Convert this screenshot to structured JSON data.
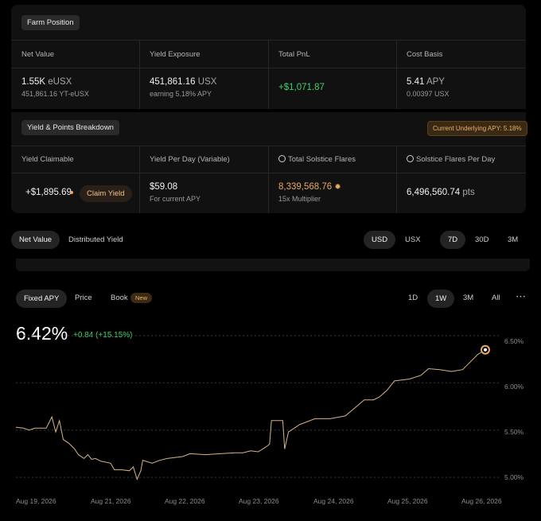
{
  "farm": {
    "section_title": "Farm Position",
    "columns": [
      {
        "label": "Net Value",
        "value": "1.55K",
        "unit": "eUSX",
        "sub": "451,861.16 YT-eUSX"
      },
      {
        "label": "Yield Exposure",
        "value": "451,861.16",
        "unit": "USX",
        "sub": "earning 5.18% APY"
      },
      {
        "label": "Total PnL",
        "value": "+$1,071.87",
        "unit": "",
        "sub": ""
      },
      {
        "label": "Cost Basis",
        "value": "5.41",
        "unit": "APY",
        "sub": "0.00397 USX"
      }
    ]
  },
  "breakdown": {
    "section_title": "Yield & Points Breakdown",
    "badge": "Current Underlying APY: 5.18%",
    "columns": [
      {
        "label": "Yield Claimable",
        "value": "+$1,895.69",
        "button": "Claim Yield"
      },
      {
        "label": "Yield Per Day (Variable)",
        "value": "$59.08",
        "sub": "For current APY"
      },
      {
        "label": "Total Solstice Flares",
        "value": "8,339,568.76",
        "sub": "15x Multiplier"
      },
      {
        "label": "Solstice Flares Per Day",
        "value": "6,496,560.74",
        "unit": "pts"
      }
    ]
  },
  "view_tabs": {
    "net_value": "Net Value",
    "distributed_yield": "Distributed Yield"
  },
  "currency_tabs": {
    "usd": "USD",
    "usx": "USX"
  },
  "range_tabs": {
    "d7": "7D",
    "d30": "30D",
    "m3": "3M"
  },
  "chart_tabs": {
    "fixed_apy": "Fixed APY",
    "price": "Price",
    "book": "Book",
    "new_badge": "New"
  },
  "chart_range_tabs": {
    "d1": "1D",
    "w1": "1W",
    "m3": "3M",
    "all": "All",
    "more": "⋯"
  },
  "headline": {
    "value": "6.42%",
    "change": "+0.84 (+15.15%)"
  },
  "colors": {
    "accent": "#e8a861",
    "positive": "#3ed26a",
    "line": "#d9b489"
  },
  "chart_data": {
    "type": "line",
    "title": "",
    "xlabel": "",
    "ylabel": "",
    "x_ticks": [
      "Aug 19, 2026",
      "Aug 21, 2026",
      "Aug 22, 2026",
      "Aug 23, 2026",
      "Aug 24, 2026",
      "Aug 25, 2026",
      "Aug 26, 2026"
    ],
    "y_ticks": [
      "6.50%",
      "6.00%",
      "5.50%",
      "5.00%"
    ],
    "ylim": [
      4.9,
      6.6
    ],
    "grid": true,
    "series": [
      {
        "values": [
          [
            0,
            5.53
          ],
          [
            0.2,
            5.52
          ],
          [
            0.35,
            5.5
          ],
          [
            0.5,
            5.52
          ],
          [
            0.8,
            5.52
          ],
          [
            0.95,
            5.64
          ],
          [
            1.05,
            5.48
          ],
          [
            1.15,
            5.6
          ],
          [
            1.25,
            5.4
          ],
          [
            1.4,
            5.36
          ],
          [
            1.55,
            5.3
          ],
          [
            1.65,
            5.24
          ],
          [
            1.8,
            5.2
          ],
          [
            1.9,
            5.24
          ],
          [
            2.0,
            5.19
          ],
          [
            2.1,
            5.2
          ],
          [
            2.25,
            5.17
          ],
          [
            2.5,
            5.15
          ],
          [
            2.6,
            5.08
          ],
          [
            2.8,
            5.08
          ],
          [
            3.0,
            5.07
          ],
          [
            3.1,
            5.11
          ],
          [
            3.2,
            4.98
          ],
          [
            3.3,
            5.07
          ],
          [
            3.35,
            5.18
          ],
          [
            3.6,
            5.15
          ],
          [
            3.8,
            5.18
          ],
          [
            4.0,
            5.2
          ],
          [
            4.4,
            5.22
          ],
          [
            4.6,
            5.25
          ],
          [
            5.0,
            5.24
          ],
          [
            5.4,
            5.25
          ],
          [
            5.8,
            5.26
          ],
          [
            6.0,
            5.26
          ],
          [
            6.2,
            5.28
          ],
          [
            6.4,
            5.27
          ],
          [
            6.6,
            5.32
          ],
          [
            6.7,
            5.35
          ],
          [
            6.75,
            5.6
          ],
          [
            6.9,
            5.6
          ],
          [
            7.05,
            5.6
          ],
          [
            7.1,
            5.3
          ],
          [
            7.2,
            5.48
          ],
          [
            7.5,
            5.56
          ],
          [
            7.9,
            5.62
          ],
          [
            8.3,
            5.62
          ],
          [
            8.7,
            5.65
          ],
          [
            9.0,
            5.75
          ],
          [
            9.2,
            5.82
          ],
          [
            9.45,
            5.82
          ],
          [
            9.6,
            5.85
          ],
          [
            9.8,
            5.92
          ],
          [
            10.0,
            6.02
          ],
          [
            10.4,
            6.04
          ],
          [
            10.7,
            6.08
          ],
          [
            10.9,
            6.15
          ],
          [
            11.2,
            6.14
          ],
          [
            11.5,
            6.12
          ],
          [
            11.8,
            6.14
          ],
          [
            12.0,
            6.22
          ],
          [
            12.2,
            6.3
          ],
          [
            12.4,
            6.35
          ]
        ]
      }
    ],
    "end_marker": true
  }
}
